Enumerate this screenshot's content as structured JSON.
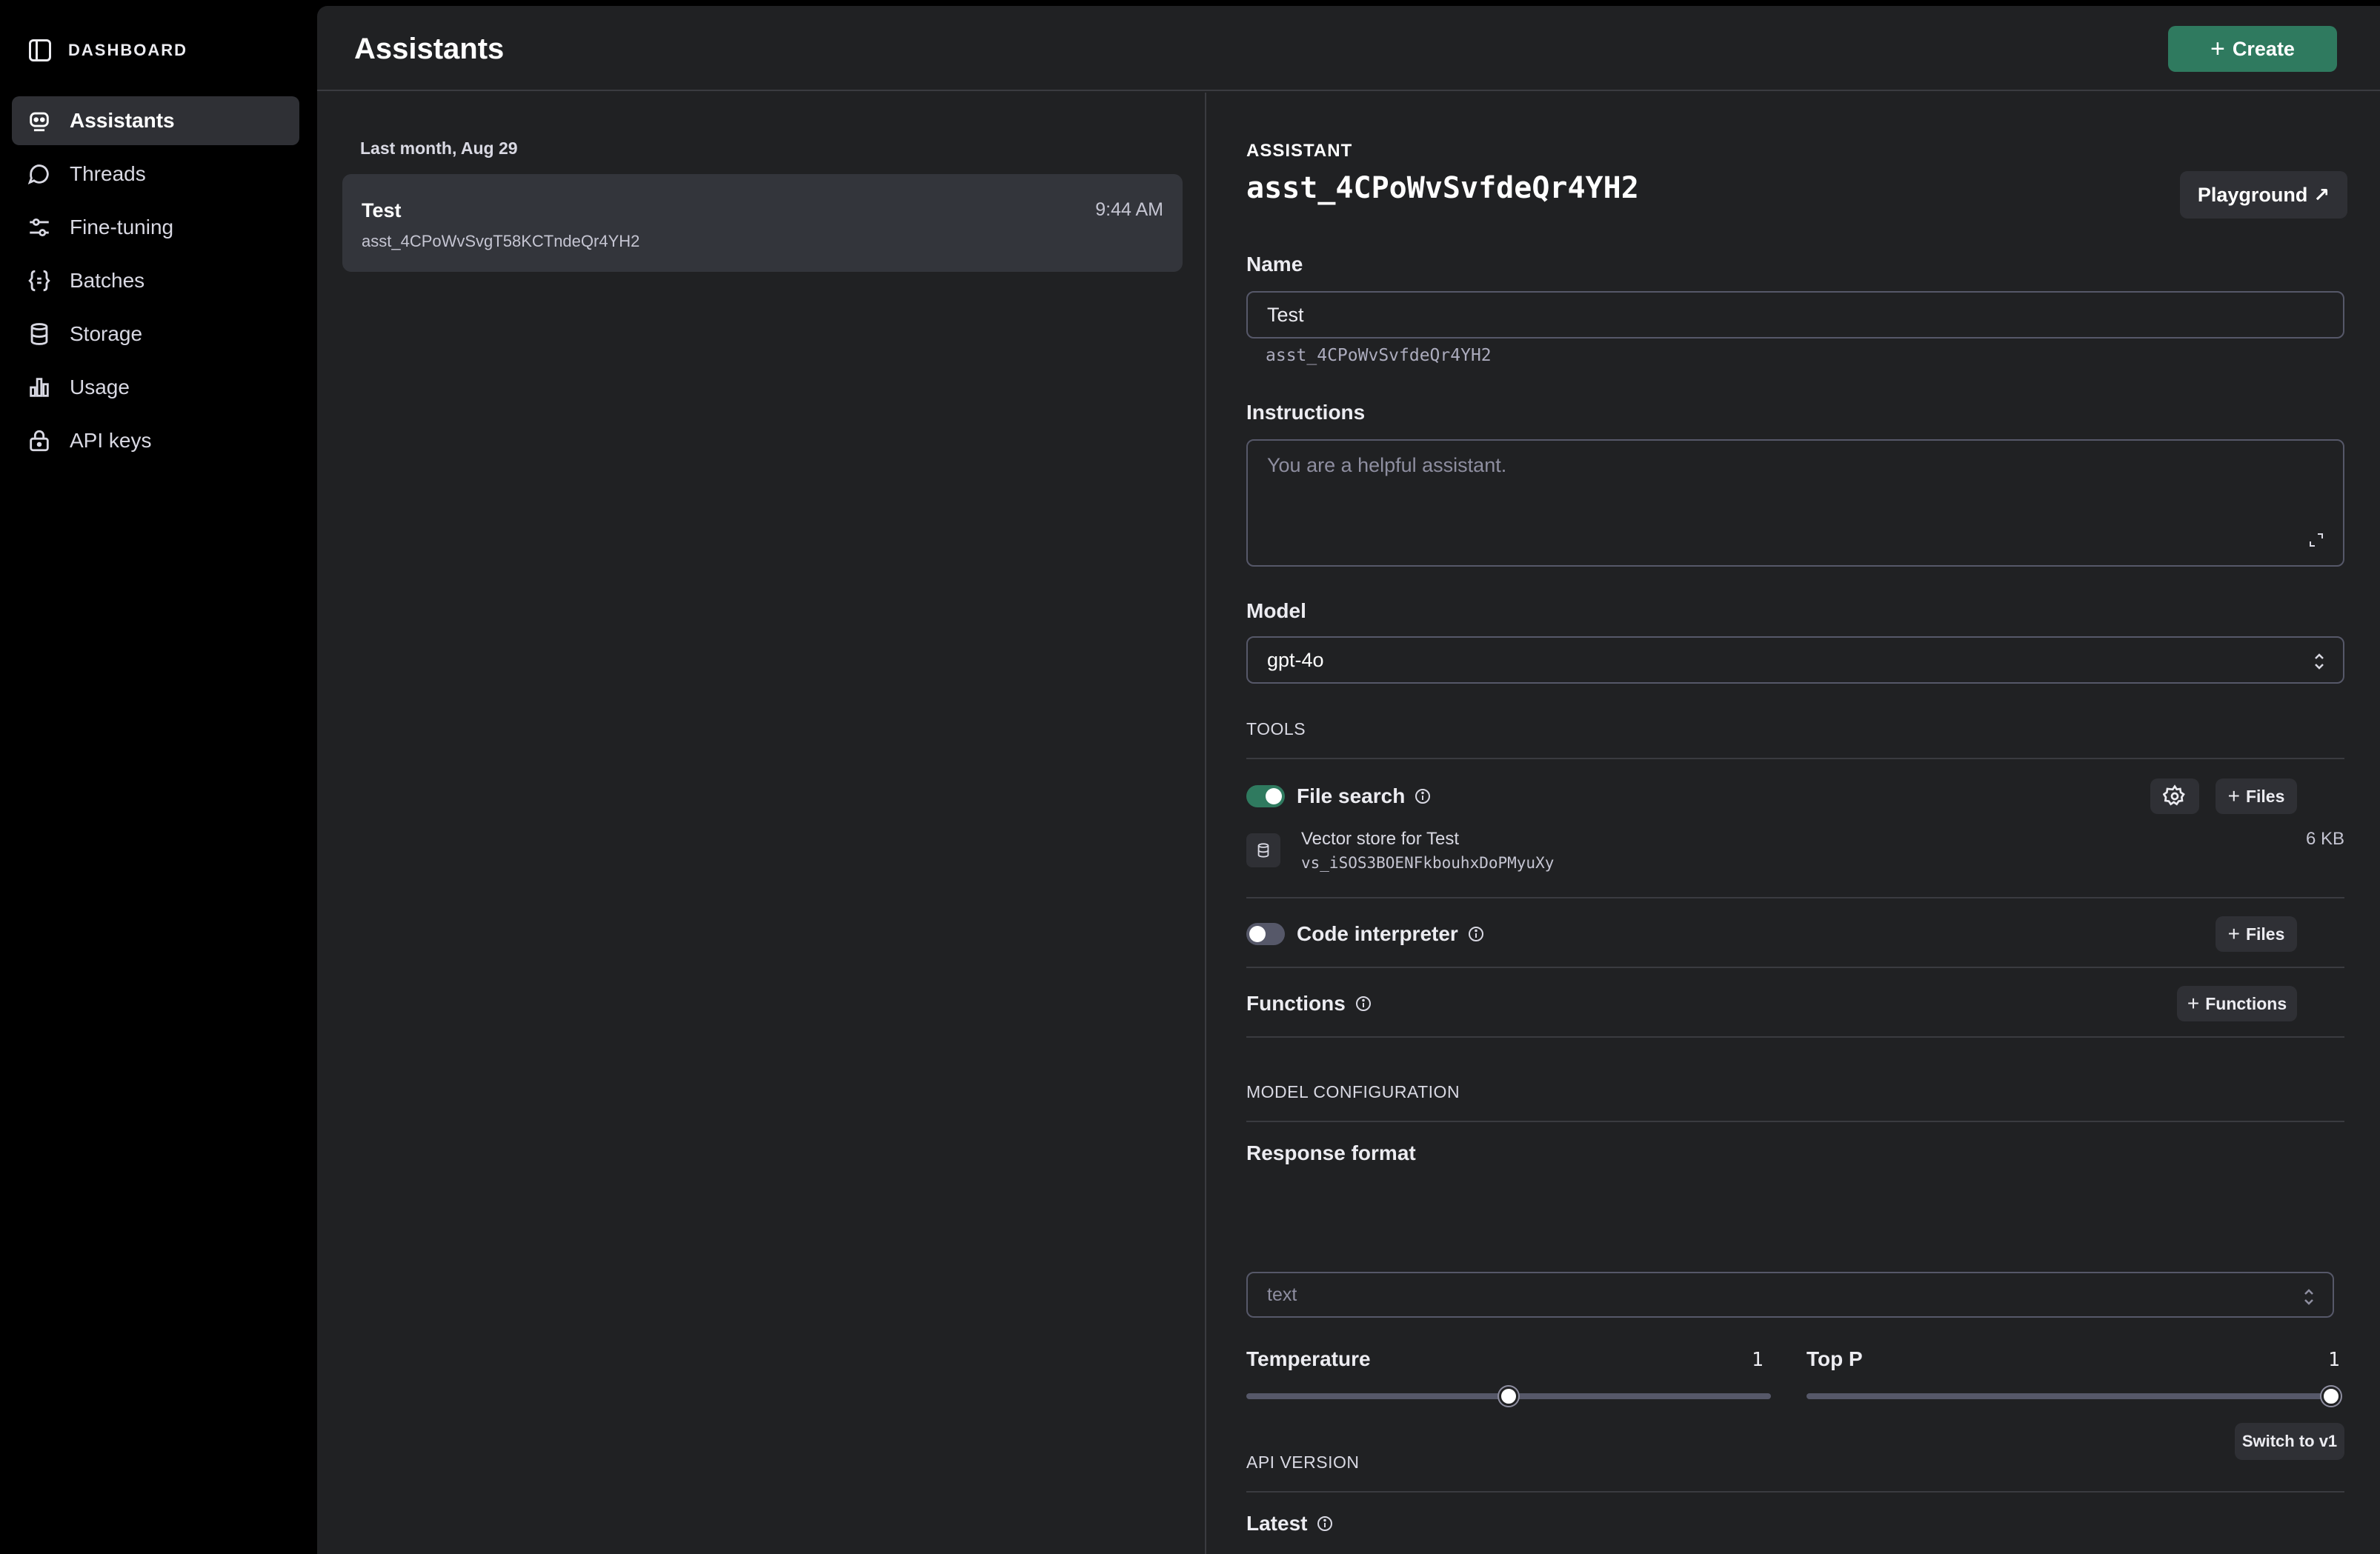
{
  "sidebar": {
    "header": "DASHBOARD",
    "items": [
      {
        "label": "Assistants",
        "icon": "robot-icon",
        "active": true
      },
      {
        "label": "Threads",
        "icon": "chat-bubbles-icon"
      },
      {
        "label": "Fine-tuning",
        "icon": "sliders-icon"
      },
      {
        "label": "Batches",
        "icon": "braces-icon"
      },
      {
        "label": "Storage",
        "icon": "database-icon"
      },
      {
        "label": "Usage",
        "icon": "bar-chart-icon"
      },
      {
        "label": "API keys",
        "icon": "lock-icon"
      }
    ]
  },
  "header": {
    "title": "Assistants",
    "create_label": "Create"
  },
  "list": {
    "group_label": "Last month, Aug 29",
    "items": [
      {
        "name": "Test",
        "id": "asst_4CPoWvSvgT58KCTndeQr4YH2",
        "time": "9:44 AM"
      }
    ]
  },
  "detail": {
    "kicker": "ASSISTANT",
    "assistant_id": "asst_4CPoWvSvfdeQr4YH2",
    "playground_label": "Playground",
    "name_label": "Name",
    "name_value": "Test",
    "name_sub": "asst_4CPoWvSvfdeQr4YH2",
    "instructions_label": "Instructions",
    "instructions_placeholder": "You are a helpful assistant.",
    "model_label": "Model",
    "model_value": "gpt-4o",
    "tools_label": "TOOLS",
    "tools": {
      "file_search": {
        "label": "File search",
        "enabled": true,
        "files_label": "Files"
      },
      "vector_store": {
        "name": "Vector store for Test",
        "id": "vs_iSOS3BOENFkbouhxDoPMyuXy",
        "size": "6 KB"
      },
      "code_interpreter": {
        "label": "Code interpreter",
        "enabled": false,
        "files_label": "Files"
      },
      "functions": {
        "label": "Functions",
        "button_label": "Functions"
      }
    },
    "model_config_label": "MODEL CONFIGURATION",
    "response_format_label": "Response format",
    "response_format_value": "text",
    "temperature": {
      "label": "Temperature",
      "value": "1",
      "fraction": 0.5
    },
    "top_p": {
      "label": "Top P",
      "value": "1",
      "fraction": 1.0
    },
    "api_version_label": "API VERSION",
    "api_version_value": "Latest",
    "switch_label": "Switch to v1"
  },
  "colors": {
    "accent": "#2f7a5f",
    "background": "#202123",
    "sidebar": "#000000"
  }
}
